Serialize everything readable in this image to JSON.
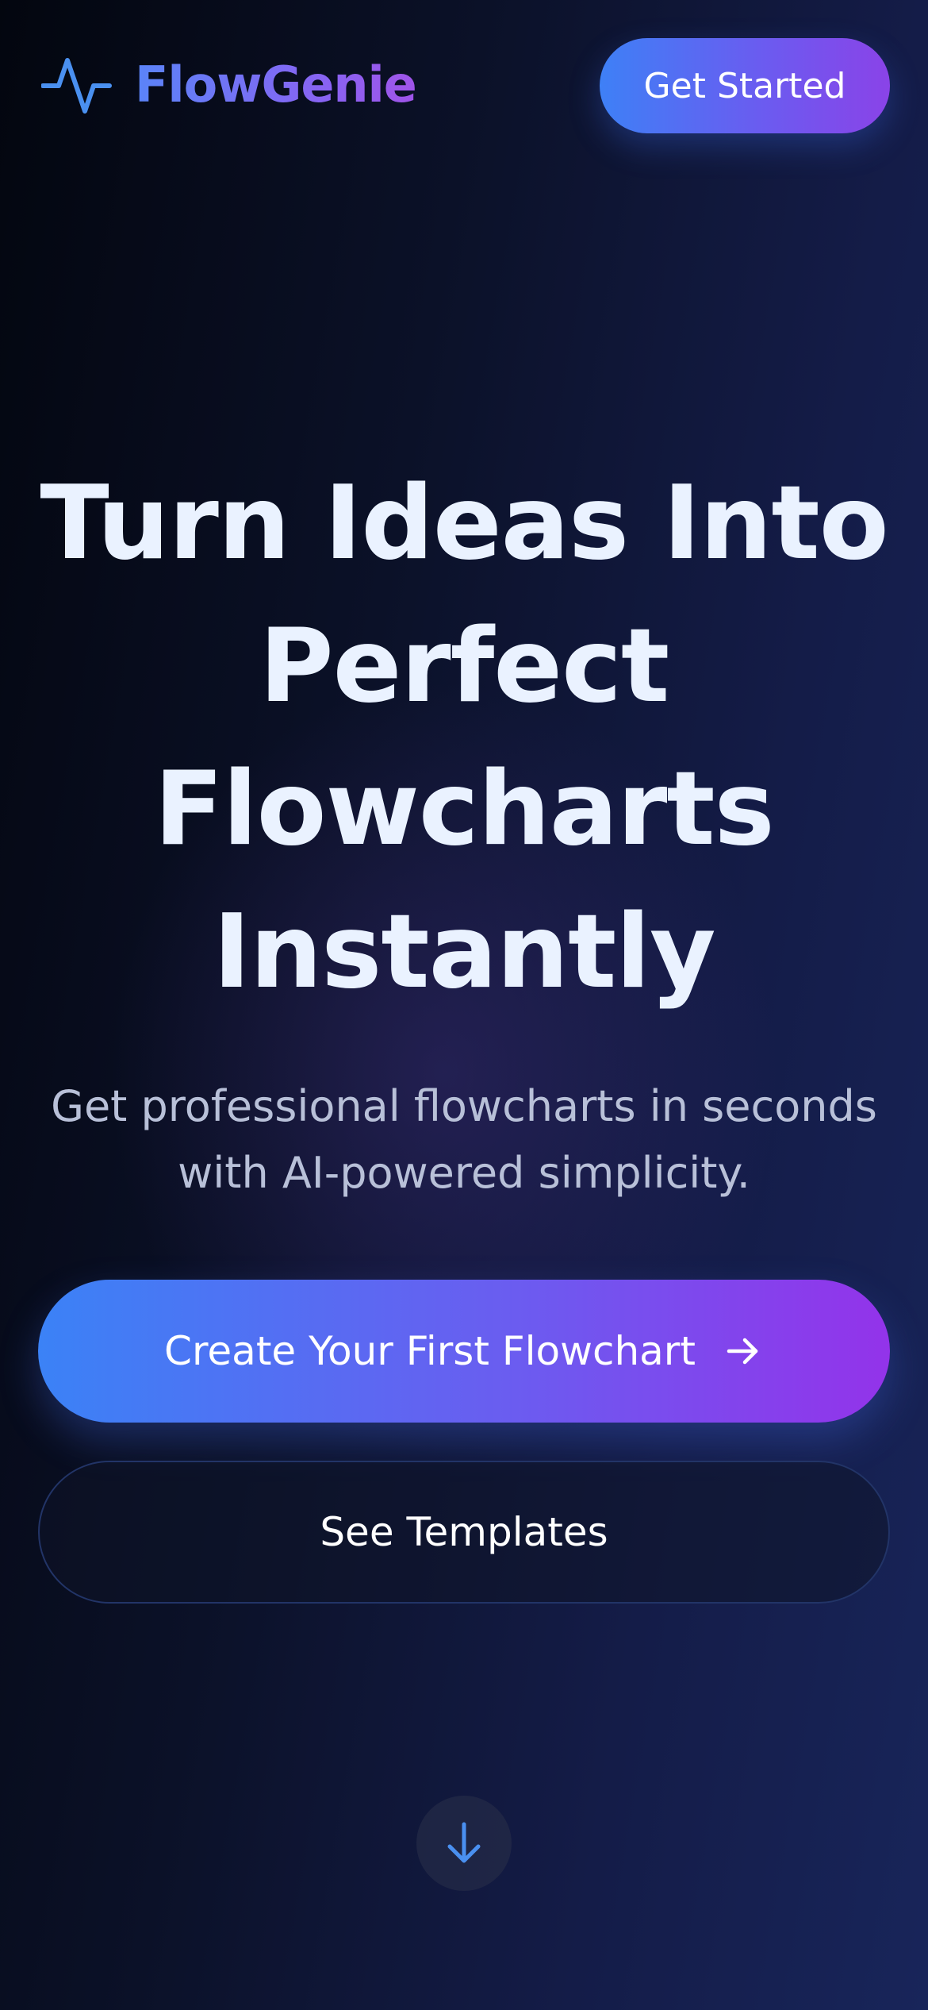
{
  "brand": {
    "name": "FlowGenie",
    "icon": "pulse-activity-icon"
  },
  "header": {
    "cta_label": "Get Started"
  },
  "hero": {
    "title_lines": [
      "Turn Ideas Into",
      "Perfect",
      "Flowcharts",
      "Instantly"
    ],
    "subtitle_lines": [
      "Get professional flowcharts in seconds",
      "with AI-powered simplicity."
    ]
  },
  "actions": {
    "primary_label": "Create Your First Flowchart",
    "primary_icon": "arrow-right-icon",
    "secondary_label": "See Templates"
  },
  "scroll": {
    "icon": "arrow-down-icon"
  },
  "colors": {
    "background_dark": "#03060f",
    "background_navy": "#18255a",
    "accent_blue": "#3b82f6",
    "accent_purple": "#9333ea",
    "title_text": "#eaf2ff",
    "subtitle_text": "#b8c0d8",
    "icon_blue": "#4a90f0"
  }
}
